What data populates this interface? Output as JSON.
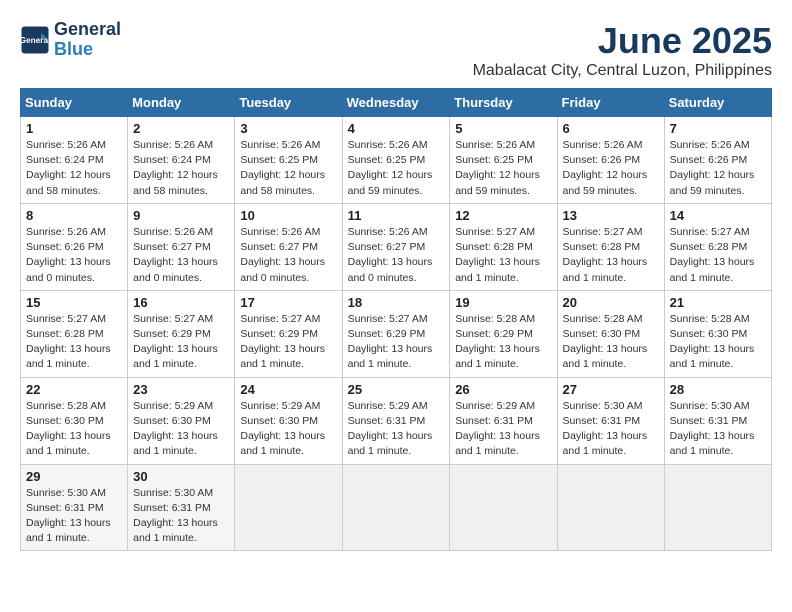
{
  "header": {
    "logo_line1": "General",
    "logo_line2": "Blue",
    "month": "June 2025",
    "location": "Mabalacat City, Central Luzon, Philippines"
  },
  "weekdays": [
    "Sunday",
    "Monday",
    "Tuesday",
    "Wednesday",
    "Thursday",
    "Friday",
    "Saturday"
  ],
  "weeks": [
    [
      {
        "day": "1",
        "rise": "5:26 AM",
        "set": "6:24 PM",
        "daylight": "12 hours and 58 minutes."
      },
      {
        "day": "2",
        "rise": "5:26 AM",
        "set": "6:24 PM",
        "daylight": "12 hours and 58 minutes."
      },
      {
        "day": "3",
        "rise": "5:26 AM",
        "set": "6:25 PM",
        "daylight": "12 hours and 58 minutes."
      },
      {
        "day": "4",
        "rise": "5:26 AM",
        "set": "6:25 PM",
        "daylight": "12 hours and 59 minutes."
      },
      {
        "day": "5",
        "rise": "5:26 AM",
        "set": "6:25 PM",
        "daylight": "12 hours and 59 minutes."
      },
      {
        "day": "6",
        "rise": "5:26 AM",
        "set": "6:26 PM",
        "daylight": "12 hours and 59 minutes."
      },
      {
        "day": "7",
        "rise": "5:26 AM",
        "set": "6:26 PM",
        "daylight": "12 hours and 59 minutes."
      }
    ],
    [
      {
        "day": "8",
        "rise": "5:26 AM",
        "set": "6:26 PM",
        "daylight": "13 hours and 0 minutes."
      },
      {
        "day": "9",
        "rise": "5:26 AM",
        "set": "6:27 PM",
        "daylight": "13 hours and 0 minutes."
      },
      {
        "day": "10",
        "rise": "5:26 AM",
        "set": "6:27 PM",
        "daylight": "13 hours and 0 minutes."
      },
      {
        "day": "11",
        "rise": "5:26 AM",
        "set": "6:27 PM",
        "daylight": "13 hours and 0 minutes."
      },
      {
        "day": "12",
        "rise": "5:27 AM",
        "set": "6:28 PM",
        "daylight": "13 hours and 1 minute."
      },
      {
        "day": "13",
        "rise": "5:27 AM",
        "set": "6:28 PM",
        "daylight": "13 hours and 1 minute."
      },
      {
        "day": "14",
        "rise": "5:27 AM",
        "set": "6:28 PM",
        "daylight": "13 hours and 1 minute."
      }
    ],
    [
      {
        "day": "15",
        "rise": "5:27 AM",
        "set": "6:28 PM",
        "daylight": "13 hours and 1 minute."
      },
      {
        "day": "16",
        "rise": "5:27 AM",
        "set": "6:29 PM",
        "daylight": "13 hours and 1 minute."
      },
      {
        "day": "17",
        "rise": "5:27 AM",
        "set": "6:29 PM",
        "daylight": "13 hours and 1 minute."
      },
      {
        "day": "18",
        "rise": "5:27 AM",
        "set": "6:29 PM",
        "daylight": "13 hours and 1 minute."
      },
      {
        "day": "19",
        "rise": "5:28 AM",
        "set": "6:29 PM",
        "daylight": "13 hours and 1 minute."
      },
      {
        "day": "20",
        "rise": "5:28 AM",
        "set": "6:30 PM",
        "daylight": "13 hours and 1 minute."
      },
      {
        "day": "21",
        "rise": "5:28 AM",
        "set": "6:30 PM",
        "daylight": "13 hours and 1 minute."
      }
    ],
    [
      {
        "day": "22",
        "rise": "5:28 AM",
        "set": "6:30 PM",
        "daylight": "13 hours and 1 minute."
      },
      {
        "day": "23",
        "rise": "5:29 AM",
        "set": "6:30 PM",
        "daylight": "13 hours and 1 minute."
      },
      {
        "day": "24",
        "rise": "5:29 AM",
        "set": "6:30 PM",
        "daylight": "13 hours and 1 minute."
      },
      {
        "day": "25",
        "rise": "5:29 AM",
        "set": "6:31 PM",
        "daylight": "13 hours and 1 minute."
      },
      {
        "day": "26",
        "rise": "5:29 AM",
        "set": "6:31 PM",
        "daylight": "13 hours and 1 minute."
      },
      {
        "day": "27",
        "rise": "5:30 AM",
        "set": "6:31 PM",
        "daylight": "13 hours and 1 minute."
      },
      {
        "day": "28",
        "rise": "5:30 AM",
        "set": "6:31 PM",
        "daylight": "13 hours and 1 minute."
      }
    ],
    [
      {
        "day": "29",
        "rise": "5:30 AM",
        "set": "6:31 PM",
        "daylight": "13 hours and 1 minute."
      },
      {
        "day": "30",
        "rise": "5:30 AM",
        "set": "6:31 PM",
        "daylight": "13 hours and 1 minute."
      },
      null,
      null,
      null,
      null,
      null
    ]
  ],
  "labels": {
    "sunrise": "Sunrise:",
    "sunset": "Sunset:",
    "daylight": "Daylight:"
  }
}
